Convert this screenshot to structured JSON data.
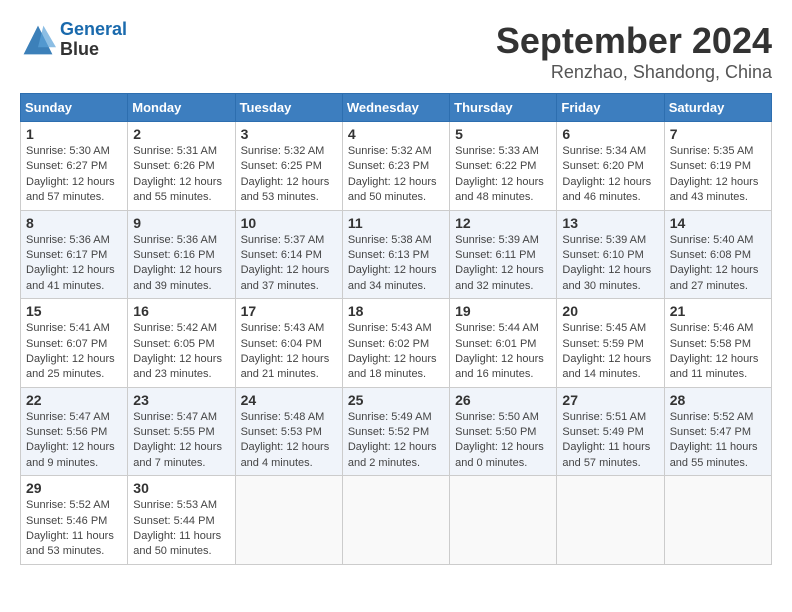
{
  "logo": {
    "line1": "General",
    "line2": "Blue"
  },
  "title": "September 2024",
  "location": "Renzhao, Shandong, China",
  "days_of_week": [
    "Sunday",
    "Monday",
    "Tuesday",
    "Wednesday",
    "Thursday",
    "Friday",
    "Saturday"
  ],
  "weeks": [
    [
      {
        "day": "1",
        "info": "Sunrise: 5:30 AM\nSunset: 6:27 PM\nDaylight: 12 hours and 57 minutes."
      },
      {
        "day": "2",
        "info": "Sunrise: 5:31 AM\nSunset: 6:26 PM\nDaylight: 12 hours and 55 minutes."
      },
      {
        "day": "3",
        "info": "Sunrise: 5:32 AM\nSunset: 6:25 PM\nDaylight: 12 hours and 53 minutes."
      },
      {
        "day": "4",
        "info": "Sunrise: 5:32 AM\nSunset: 6:23 PM\nDaylight: 12 hours and 50 minutes."
      },
      {
        "day": "5",
        "info": "Sunrise: 5:33 AM\nSunset: 6:22 PM\nDaylight: 12 hours and 48 minutes."
      },
      {
        "day": "6",
        "info": "Sunrise: 5:34 AM\nSunset: 6:20 PM\nDaylight: 12 hours and 46 minutes."
      },
      {
        "day": "7",
        "info": "Sunrise: 5:35 AM\nSunset: 6:19 PM\nDaylight: 12 hours and 43 minutes."
      }
    ],
    [
      {
        "day": "8",
        "info": "Sunrise: 5:36 AM\nSunset: 6:17 PM\nDaylight: 12 hours and 41 minutes."
      },
      {
        "day": "9",
        "info": "Sunrise: 5:36 AM\nSunset: 6:16 PM\nDaylight: 12 hours and 39 minutes."
      },
      {
        "day": "10",
        "info": "Sunrise: 5:37 AM\nSunset: 6:14 PM\nDaylight: 12 hours and 37 minutes."
      },
      {
        "day": "11",
        "info": "Sunrise: 5:38 AM\nSunset: 6:13 PM\nDaylight: 12 hours and 34 minutes."
      },
      {
        "day": "12",
        "info": "Sunrise: 5:39 AM\nSunset: 6:11 PM\nDaylight: 12 hours and 32 minutes."
      },
      {
        "day": "13",
        "info": "Sunrise: 5:39 AM\nSunset: 6:10 PM\nDaylight: 12 hours and 30 minutes."
      },
      {
        "day": "14",
        "info": "Sunrise: 5:40 AM\nSunset: 6:08 PM\nDaylight: 12 hours and 27 minutes."
      }
    ],
    [
      {
        "day": "15",
        "info": "Sunrise: 5:41 AM\nSunset: 6:07 PM\nDaylight: 12 hours and 25 minutes."
      },
      {
        "day": "16",
        "info": "Sunrise: 5:42 AM\nSunset: 6:05 PM\nDaylight: 12 hours and 23 minutes."
      },
      {
        "day": "17",
        "info": "Sunrise: 5:43 AM\nSunset: 6:04 PM\nDaylight: 12 hours and 21 minutes."
      },
      {
        "day": "18",
        "info": "Sunrise: 5:43 AM\nSunset: 6:02 PM\nDaylight: 12 hours and 18 minutes."
      },
      {
        "day": "19",
        "info": "Sunrise: 5:44 AM\nSunset: 6:01 PM\nDaylight: 12 hours and 16 minutes."
      },
      {
        "day": "20",
        "info": "Sunrise: 5:45 AM\nSunset: 5:59 PM\nDaylight: 12 hours and 14 minutes."
      },
      {
        "day": "21",
        "info": "Sunrise: 5:46 AM\nSunset: 5:58 PM\nDaylight: 12 hours and 11 minutes."
      }
    ],
    [
      {
        "day": "22",
        "info": "Sunrise: 5:47 AM\nSunset: 5:56 PM\nDaylight: 12 hours and 9 minutes."
      },
      {
        "day": "23",
        "info": "Sunrise: 5:47 AM\nSunset: 5:55 PM\nDaylight: 12 hours and 7 minutes."
      },
      {
        "day": "24",
        "info": "Sunrise: 5:48 AM\nSunset: 5:53 PM\nDaylight: 12 hours and 4 minutes."
      },
      {
        "day": "25",
        "info": "Sunrise: 5:49 AM\nSunset: 5:52 PM\nDaylight: 12 hours and 2 minutes."
      },
      {
        "day": "26",
        "info": "Sunrise: 5:50 AM\nSunset: 5:50 PM\nDaylight: 12 hours and 0 minutes."
      },
      {
        "day": "27",
        "info": "Sunrise: 5:51 AM\nSunset: 5:49 PM\nDaylight: 11 hours and 57 minutes."
      },
      {
        "day": "28",
        "info": "Sunrise: 5:52 AM\nSunset: 5:47 PM\nDaylight: 11 hours and 55 minutes."
      }
    ],
    [
      {
        "day": "29",
        "info": "Sunrise: 5:52 AM\nSunset: 5:46 PM\nDaylight: 11 hours and 53 minutes."
      },
      {
        "day": "30",
        "info": "Sunrise: 5:53 AM\nSunset: 5:44 PM\nDaylight: 11 hours and 50 minutes."
      },
      {
        "day": "",
        "info": ""
      },
      {
        "day": "",
        "info": ""
      },
      {
        "day": "",
        "info": ""
      },
      {
        "day": "",
        "info": ""
      },
      {
        "day": "",
        "info": ""
      }
    ]
  ]
}
